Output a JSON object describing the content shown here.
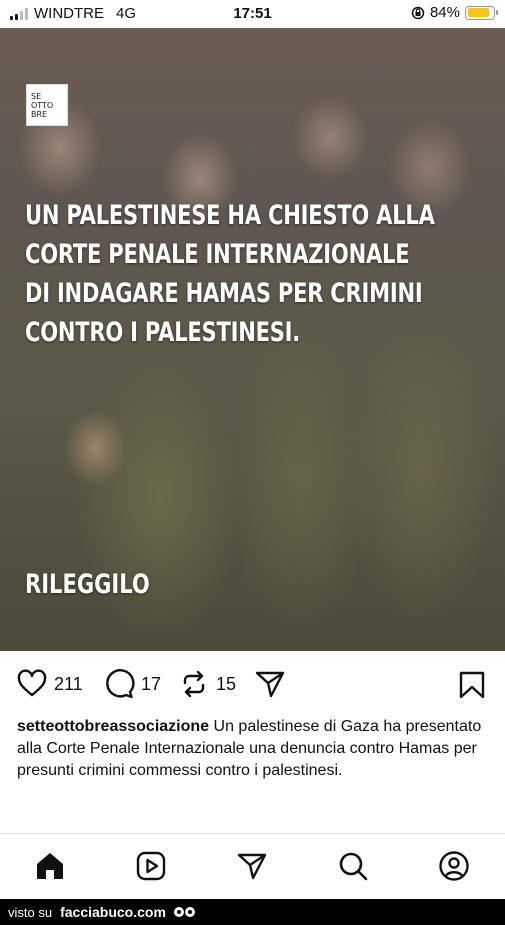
{
  "status_bar": {
    "carrier": "WINDTRE",
    "network": "4G",
    "time": "17:51",
    "battery_percent": "84%",
    "battery_level": 0.84
  },
  "post": {
    "logo_text": "SE\nOTTO\nBRE",
    "headline_lines": [
      "UN PALESTINESE HA CHIESTO ALLA",
      "CORTE PENALE INTERNAZIONALE",
      "DI INDAGARE HAMAS PER CRIMINI",
      "CONTRO I PALESTINESI."
    ],
    "cta": "RILEGGILO"
  },
  "actions": {
    "likes": "211",
    "comments": "17",
    "reposts": "15"
  },
  "caption": {
    "username": "setteottobreassociazione",
    "text": "Un palestinese di Gaza ha presentato alla Corte Penale Internazionale una denuncia contro Hamas per presunti crimini commessi contro i palestinesi."
  },
  "nav": {
    "items": [
      "home-icon",
      "reels-icon",
      "send-icon",
      "search-icon",
      "profile-icon"
    ]
  },
  "watermark": {
    "prefix": "visto su",
    "site": "facciabuco.com"
  },
  "colors": {
    "battery": "#f5c518",
    "headline": "#ffffff"
  }
}
